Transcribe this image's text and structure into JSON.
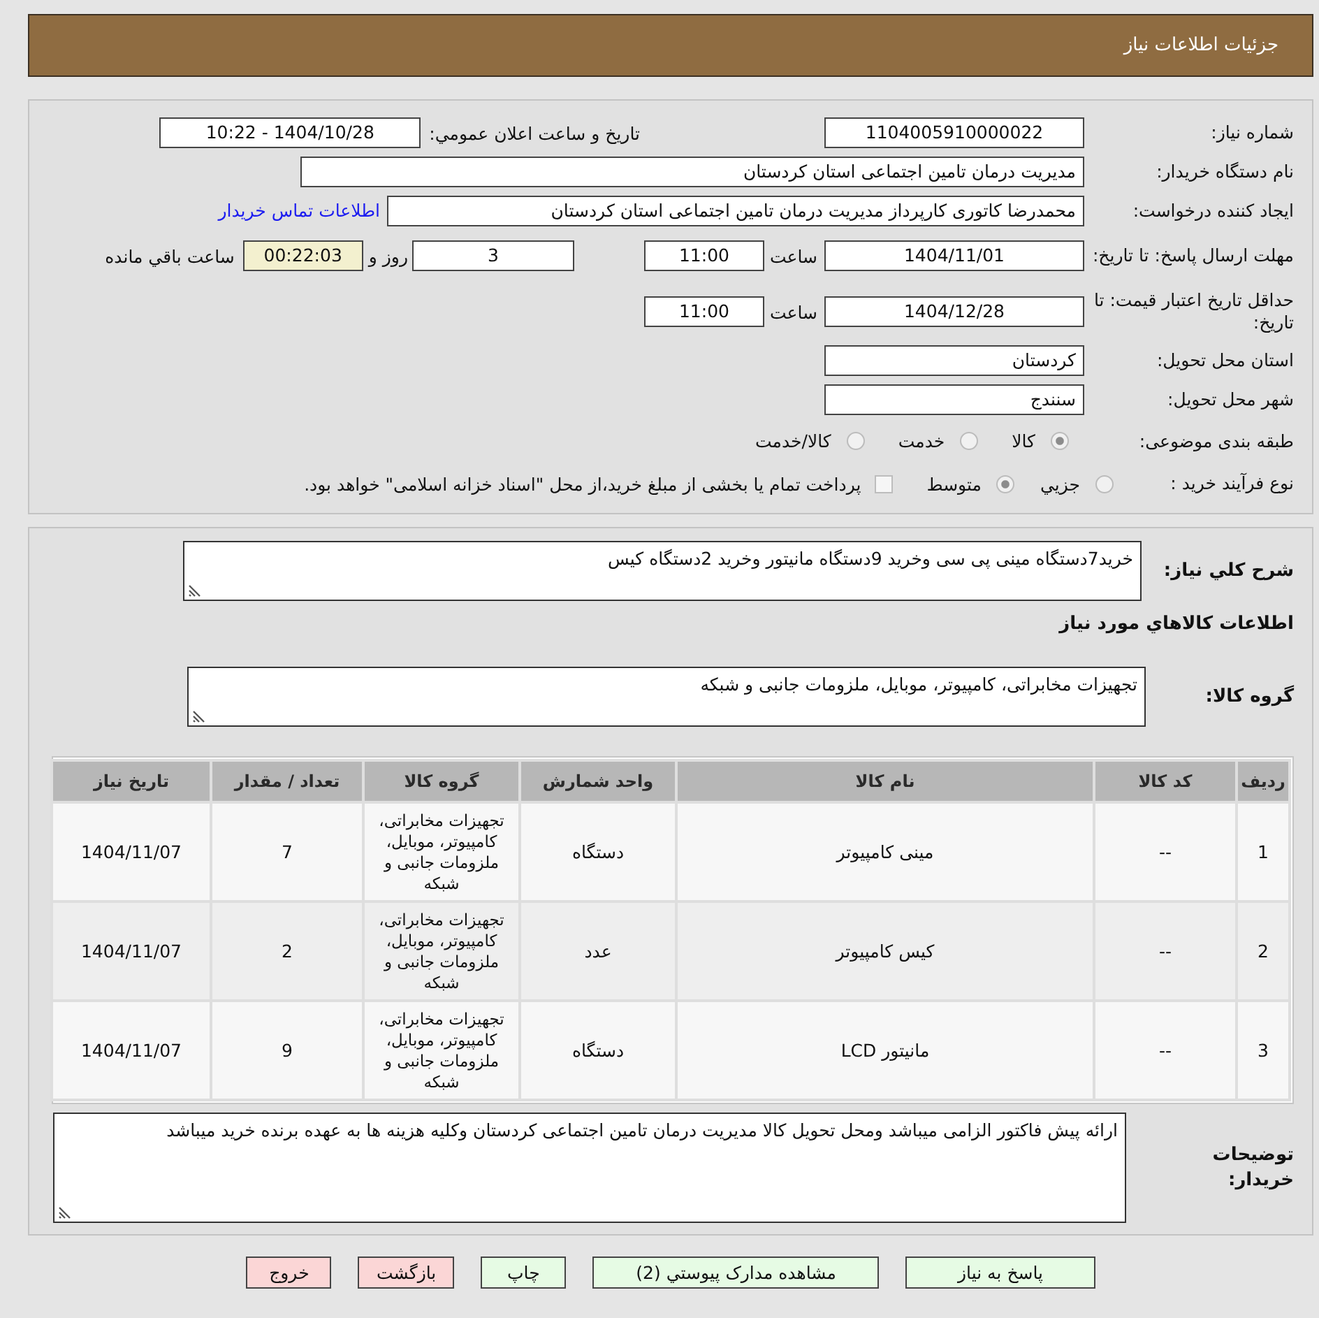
{
  "header": {
    "title": "جزئیات اطلاعات نیاز"
  },
  "details": {
    "need_number": {
      "label": "شماره نیاز:",
      "value": "1104005910000022"
    },
    "announcement": {
      "label": "تاریخ و ساعت اعلان عمومي:",
      "value": "1404/10/28 - 10:22"
    },
    "buyer_org": {
      "label": "نام دستگاه خریدار:",
      "value": "مدیریت درمان تامین اجتماعی استان کردستان"
    },
    "requester": {
      "label": "ایجاد کننده درخواست:",
      "value": "محمدرضا کاتوری کارپرداز مدیریت درمان تامین اجتماعی استان کردستان",
      "contact_link": "اطلاعات تماس خریدار"
    },
    "reply_deadline": {
      "label": "مهلت ارسال پاسخ: تا تاریخ:",
      "date": "1404/11/01",
      "time_label": "ساعت",
      "time": "11:00",
      "days": "3",
      "days_label": "روز و",
      "remaining": "00:22:03",
      "remaining_label": "ساعت باقي مانده"
    },
    "price_validity": {
      "label": "حداقل تاریخ اعتبار قیمت: تا تاریخ:",
      "date": "1404/12/28",
      "time_label": "ساعت",
      "time": "11:00"
    },
    "delivery_province": {
      "label": "استان محل تحویل:",
      "value": "کردستان"
    },
    "delivery_city": {
      "label": "شهر محل تحویل:",
      "value": "سنندج"
    },
    "subject_category": {
      "label": "طبقه بندی موضوعی:",
      "options": [
        {
          "label": "کالا",
          "selected": true
        },
        {
          "label": "خدمت",
          "selected": false
        },
        {
          "label": "کالا/خدمت",
          "selected": false
        }
      ]
    },
    "purchase_process": {
      "label": "نوع فرآیند خرید :",
      "options": [
        {
          "label": "جزيي",
          "selected": false
        },
        {
          "label": "متوسط",
          "selected": true
        }
      ],
      "treasury_payment": {
        "label": "پرداخت تمام یا بخشی از مبلغ خرید،از محل \"اسناد خزانه اسلامی\" خواهد بود.",
        "checked": false
      }
    }
  },
  "needs": {
    "description": {
      "label": "شرح کلي نیاز:",
      "value": "خرید7دستگاه مینی پی سی وخرید 9دستگاه مانیتور وخرید 2دستگاه کیس"
    },
    "goods_heading": "اطلاعات کالاهاي مورد نیاز",
    "goods_group": {
      "label": "گروه کالا:",
      "value": "تجهیزات مخابراتی، کامپیوتر، موبایل، ملزومات جانبی و شبکه"
    },
    "table": {
      "columns": [
        "ردیف",
        "کد کالا",
        "نام کالا",
        "واحد شمارش",
        "گروه کالا",
        "تعداد / مقدار",
        "تاریخ نیاز"
      ],
      "rows": [
        [
          "1",
          "--",
          "مینی کامپیوتر",
          "دستگاه",
          "تجهیزات مخابراتی، کامپیوتر، موبایل، ملزومات جانبی و شبکه",
          "7",
          "1404/11/07"
        ],
        [
          "2",
          "--",
          "کیس کامپیوتر",
          "عدد",
          "تجهیزات مخابراتی، کامپیوتر، موبایل، ملزومات جانبی و شبکه",
          "2",
          "1404/11/07"
        ],
        [
          "3",
          "--",
          "مانیتور LCD",
          "دستگاه",
          "تجهیزات مخابراتی، کامپیوتر، موبایل، ملزومات جانبی و شبکه",
          "9",
          "1404/11/07"
        ]
      ]
    },
    "buyer_notes": {
      "label": "توضیحات خریدار:",
      "value": "ارائه پیش فاکتور الزامی میباشد ومحل تحویل کالا مدیریت درمان تامین اجتماعی کردستان وکلیه هزینه ها به عهده برنده خرید میباشد"
    }
  },
  "actions": [
    {
      "label": "پاسخ به نیاز",
      "kind": "confirm"
    },
    {
      "label": "مشاهده مدارک پیوستي (2)",
      "kind": "confirm"
    },
    {
      "label": "چاپ",
      "kind": "confirm"
    },
    {
      "label": "بازگشت",
      "kind": "cancel"
    },
    {
      "label": "خروج",
      "kind": "cancel"
    }
  ]
}
